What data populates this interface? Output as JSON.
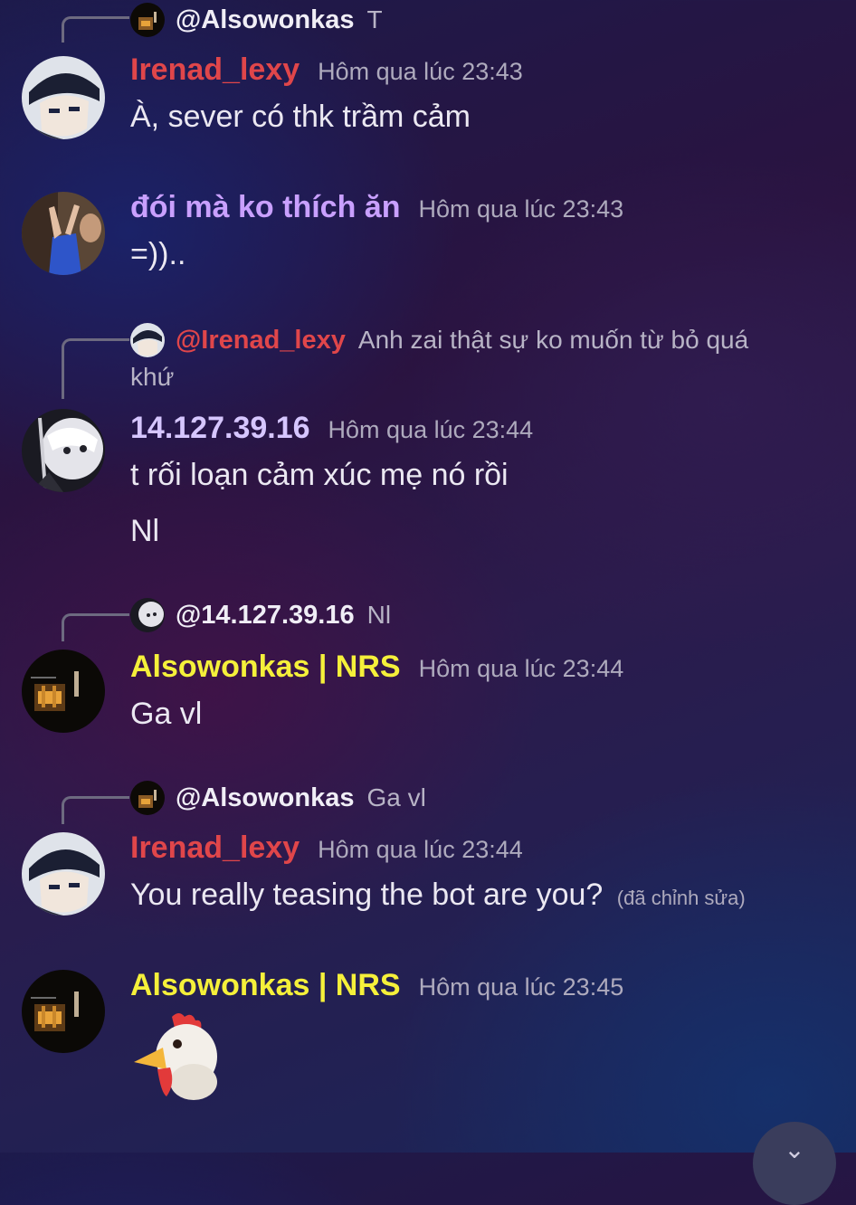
{
  "messages": [
    {
      "reply": {
        "mention": "@Alsowonkas",
        "snippet": "T"
      }
    },
    {
      "username": "Irenad_lexy",
      "timestamp": "Hôm qua lúc 23:43",
      "text": "À, sever có thk trầm cảm",
      "name_color": "#e0464a"
    },
    {
      "username": "đói mà ko thích ăn",
      "timestamp": "Hôm qua lúc 23:43",
      "text": "=)).. ",
      "name_color": "#c9a0ff"
    },
    {
      "reply": {
        "mention": "@Irenad_lexy",
        "snippet": "Anh zai thật sự ko muốn từ bỏ quá",
        "snippet_cont": "khứ"
      },
      "username": "14.127.39.16",
      "timestamp": "Hôm qua lúc 23:44",
      "text": "t rối loạn cảm xúc mẹ nó rồi",
      "text2": "Nl",
      "name_color": "#d6c6ff"
    },
    {
      "reply": {
        "mention": "@14.127.39.16",
        "snippet": "Nl"
      },
      "username": "Alsowonkas | NRS",
      "timestamp": "Hôm qua lúc 23:44",
      "text": "Ga vl",
      "name_color": "#f5f03a"
    },
    {
      "reply": {
        "mention": "@Alsowonkas",
        "snippet": "Ga vl"
      },
      "username": "Irenad_lexy",
      "timestamp": "Hôm qua lúc 23:44",
      "text": "You really teasing the bot are you?",
      "edited": "(đã chỉnh sửa)",
      "name_color": "#e0464a"
    },
    {
      "username": "Alsowonkas | NRS",
      "timestamp": "Hôm qua lúc 23:45",
      "emoji": "🐔",
      "emoji_name": "rooster-emoji",
      "name_color": "#f5f03a"
    }
  ],
  "icons": {
    "scroll_down": "chevron-down-icon"
  },
  "colors": {
    "reply_line": "#6d6a80",
    "timestamp": "#aeaabd"
  }
}
